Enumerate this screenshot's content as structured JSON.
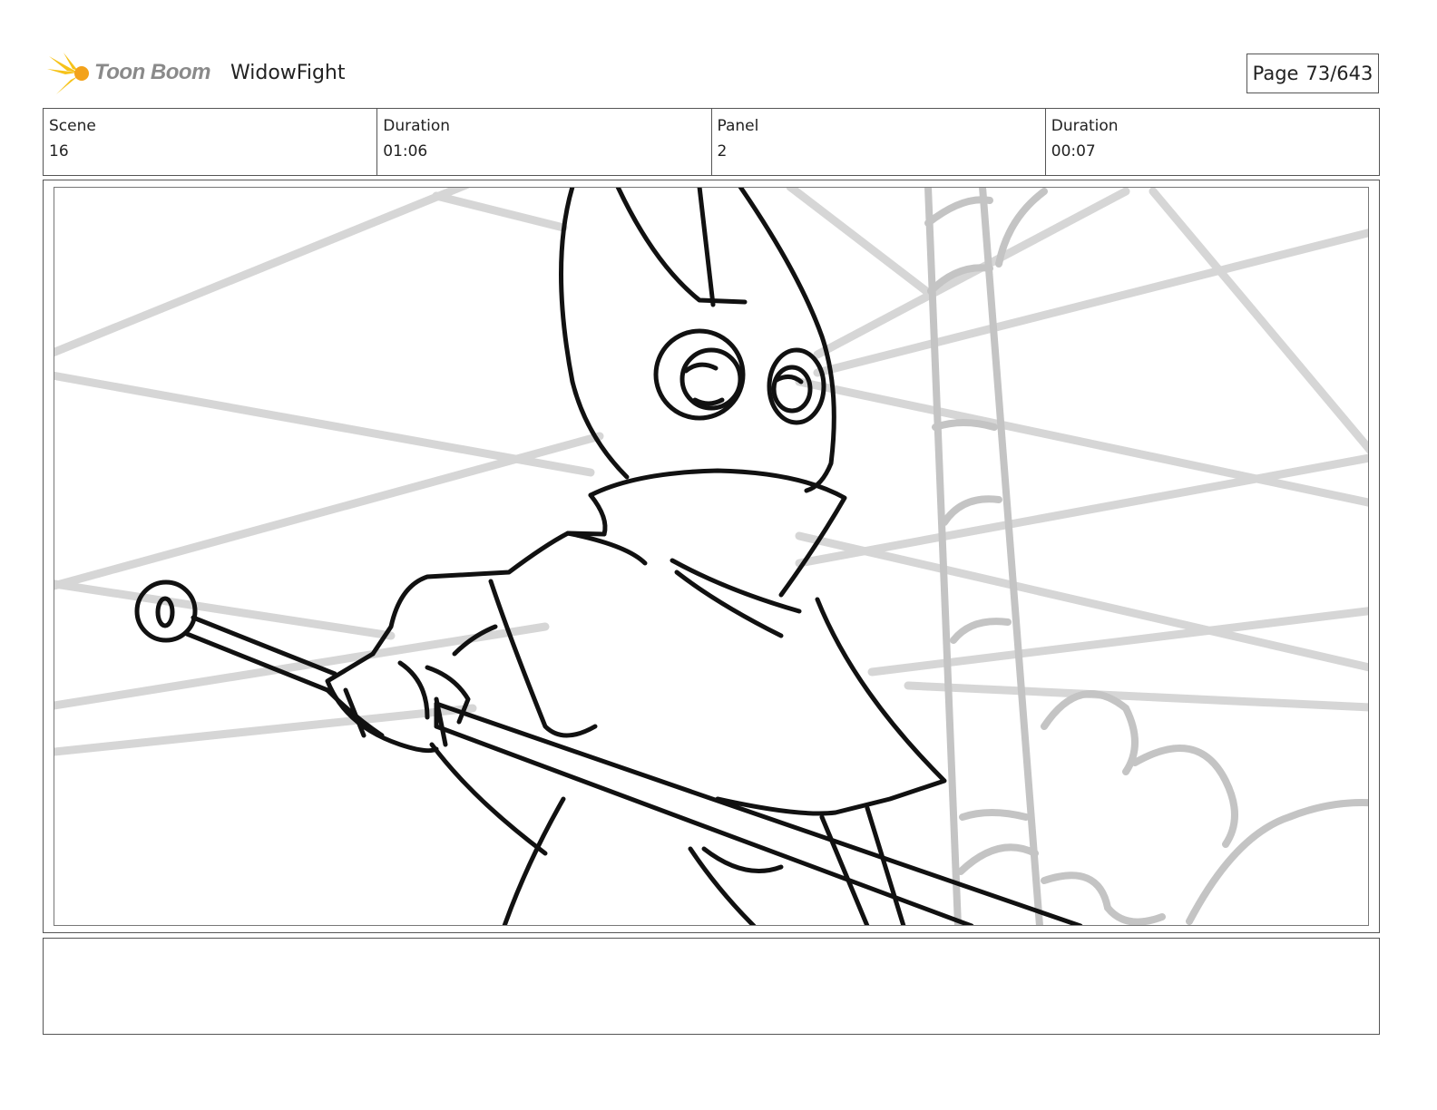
{
  "header": {
    "brand": "Toon Boom",
    "project": "WidowFight",
    "page_label": "Page",
    "page_value": "73/643"
  },
  "info": {
    "scene_label": "Scene",
    "scene_value": "16",
    "scene_duration_label": "Duration",
    "scene_duration_value": "01:06",
    "panel_label": "Panel",
    "panel_value": "2",
    "panel_duration_label": "Duration",
    "panel_duration_value": "00:07"
  },
  "notes": {
    "text": ""
  },
  "colors": {
    "logo_yellow": "#f6c31a",
    "sketch_gray": "#d0d0d0",
    "ink": "#111111"
  }
}
